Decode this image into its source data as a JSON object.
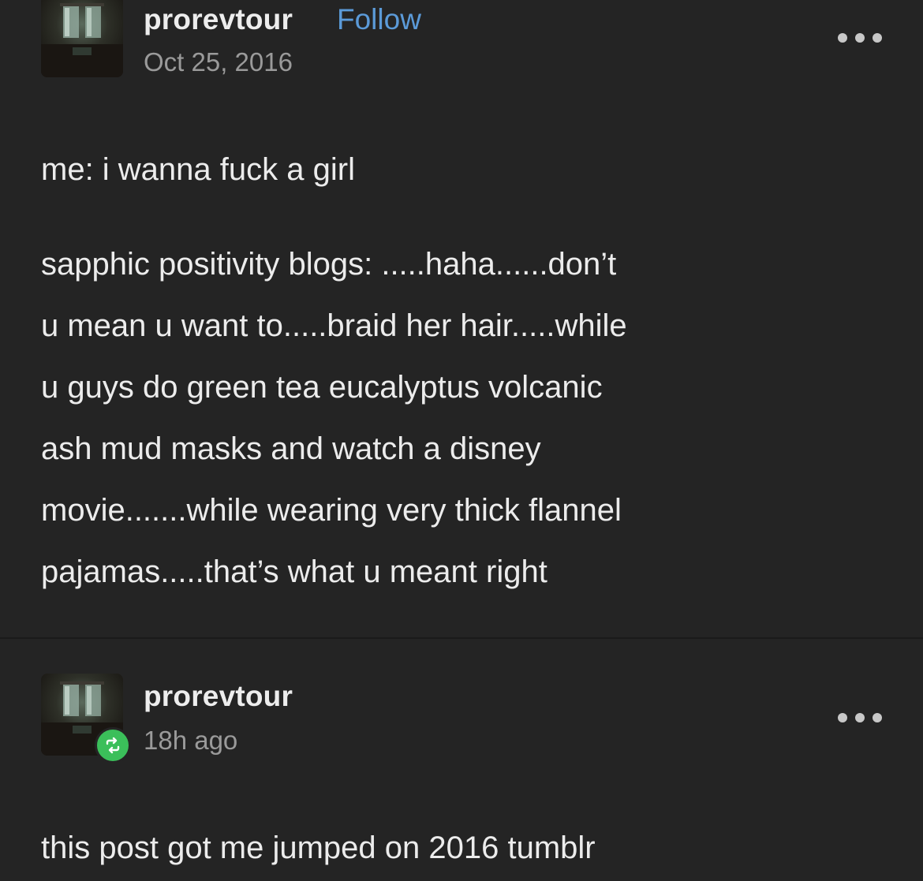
{
  "original_post": {
    "username": "prorevtour",
    "follow_label": "Follow",
    "date": "Oct 25, 2016",
    "paragraphs": [
      "me: i wanna fuck a girl",
      "sapphic positivity blogs: .....haha......don’t\nu mean u want to.....braid her hair.....while\nu guys do green tea eucalyptus volcanic\nash mud masks and watch a disney\nmovie.......while wearing very thick flannel\npajamas.....that’s what u meant right"
    ]
  },
  "reblog_post": {
    "username": "prorevtour",
    "time": "18h ago",
    "text": "this post got me jumped on 2016 tumblr"
  },
  "icons": {
    "more": "more-options-icon",
    "reblog": "reblog-icon"
  },
  "colors": {
    "background": "#242424",
    "follow_link": "#5b9ad8",
    "reblog_badge": "#3bbf5a",
    "muted_text": "#9a9a9a"
  }
}
